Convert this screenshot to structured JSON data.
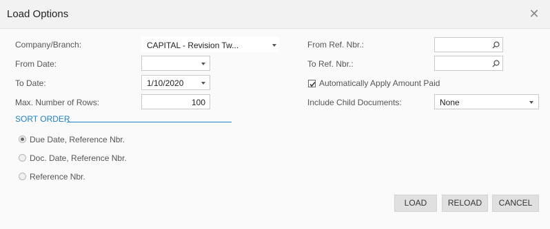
{
  "dialog": {
    "title": "Load Options",
    "close_icon": "close-icon"
  },
  "left": {
    "company_label": "Company/Branch:",
    "company_value": "CAPITAL - Revision Tw...",
    "from_date_label": "From Date:",
    "from_date_value": "",
    "to_date_label": "To Date:",
    "to_date_value": "1/10/2020",
    "max_rows_label": "Max. Number of Rows:",
    "max_rows_value": "100"
  },
  "right": {
    "from_ref_label": "From Ref. Nbr.:",
    "from_ref_value": "",
    "to_ref_label": "To Ref. Nbr.:",
    "to_ref_value": "",
    "auto_apply_label": "Automatically Apply Amount Paid",
    "auto_apply_checked": true,
    "child_docs_label": "Include Child Documents:",
    "child_docs_value": "None"
  },
  "sort": {
    "title": "SORT ORDER",
    "options": [
      {
        "label": "Due Date, Reference Nbr.",
        "selected": true
      },
      {
        "label": "Doc. Date, Reference Nbr.",
        "selected": false
      },
      {
        "label": "Reference Nbr.",
        "selected": false
      }
    ]
  },
  "buttons": {
    "load": "LOAD",
    "reload": "RELOAD",
    "cancel": "CANCEL"
  },
  "colors": {
    "accent": "#1f7fc4",
    "button_bg": "#e0e0e0"
  }
}
